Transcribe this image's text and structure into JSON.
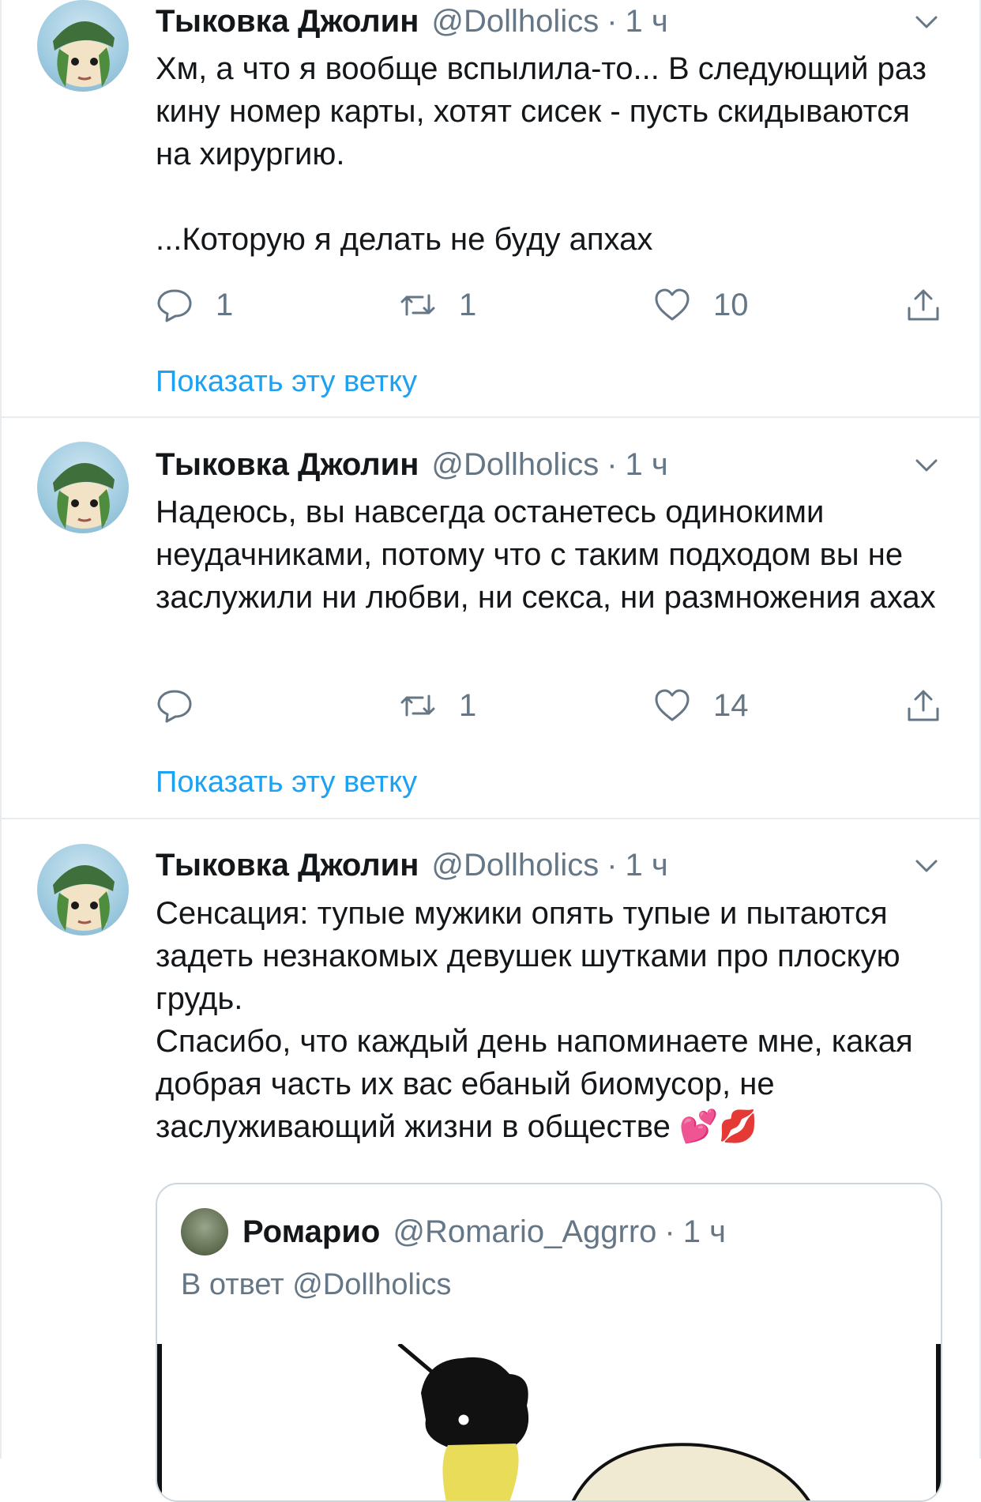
{
  "tweets": [
    {
      "name": "Тыковка Джолин",
      "handle": "@Dollholics",
      "dot": "·",
      "time": "1 ч",
      "paragraphs": [
        "Хм, а что я вообще вспылила-то... В следующий раз кину номер карты, хотят сисек - пусть скидываются на хирургию.",
        "...Которую я делать не буду апхах"
      ],
      "replies": "1",
      "retweets": "1",
      "likes": "10",
      "show_thread": "Показать эту ветку"
    },
    {
      "name": "Тыковка Джолин",
      "handle": "@Dollholics",
      "dot": "·",
      "time": "1 ч",
      "paragraphs": [
        "Надеюсь, вы навсегда останетесь одинокими неудачниками, потому что с таким подходом вы не заслужили ни любви, ни секса, ни размножения ахах"
      ],
      "replies": "",
      "retweets": "1",
      "likes": "14",
      "show_thread": "Показать эту ветку"
    },
    {
      "name": "Тыковка Джолин",
      "handle": "@Dollholics",
      "dot": "·",
      "time": "1 ч",
      "paragraphs": [
        "Сенсация: тупые мужики опять тупые и пытаются задеть незнакомых девушек шутками про плоскую грудь.",
        "Спасибо, что каждый день напоминаете мне, какая добрая часть их вас ебаный биомусор, не заслуживающий жизни в обществе 💕💋"
      ]
    }
  ],
  "quoted": {
    "name": "Ромарио",
    "handle": "@Romario_Aggrro",
    "dot": "·",
    "time": "1 ч",
    "reply_to": "В ответ @Dollholics"
  },
  "colors": {
    "link": "#1da1f2",
    "secondary_text": "#657786",
    "divider": "#e6ecf0"
  },
  "icons": [
    "reply-icon",
    "retweet-icon",
    "like-icon",
    "share-icon",
    "caret-down-icon"
  ]
}
